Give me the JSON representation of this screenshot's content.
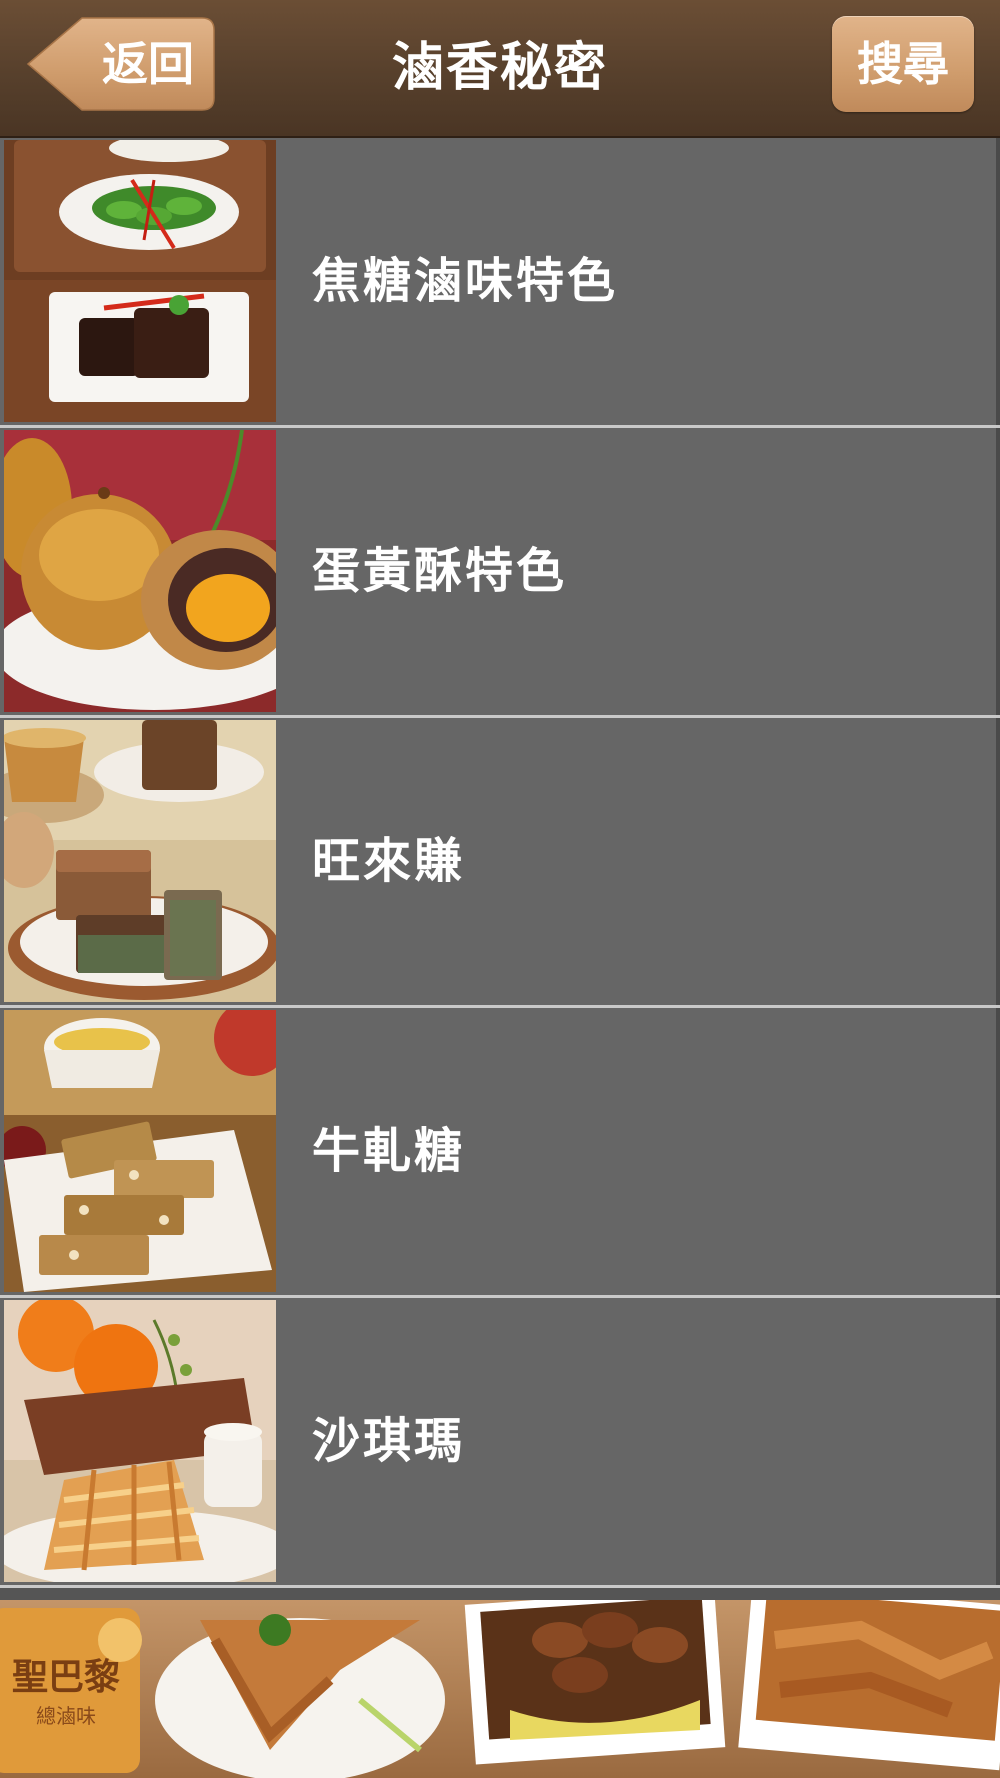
{
  "navbar": {
    "title": "滷香秘密",
    "back_label": "返回",
    "search_label": "搜尋"
  },
  "items": [
    {
      "label": "焦糖滷味特色",
      "thumb": "braised-dishes-photo"
    },
    {
      "label": "蛋黃酥特色",
      "thumb": "egg-yolk-pastry-photo"
    },
    {
      "label": "旺來賺",
      "thumb": "pineapple-cake-photo"
    },
    {
      "label": "牛軋糖",
      "thumb": "nougat-photo"
    },
    {
      "label": "沙琪瑪",
      "thumb": "sachima-photo"
    }
  ],
  "footer": {
    "logo_text": "聖巴黎",
    "logo_subtext": "總滷味",
    "banner": "braised-food-banner-photo"
  },
  "colors": {
    "navbar": "#57402c",
    "button": "#cf9c6c",
    "row": "#666666",
    "divider": "#c9c9c9",
    "text": "#ffffff"
  }
}
